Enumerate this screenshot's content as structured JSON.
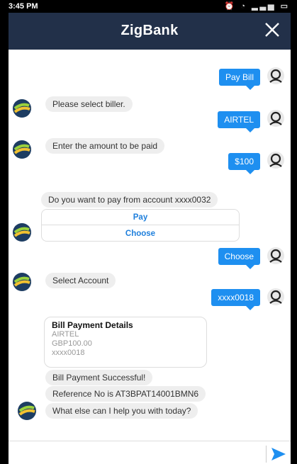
{
  "status_bar": {
    "time": "3:45 PM"
  },
  "header": {
    "title": "ZigBank"
  },
  "messages": {
    "user_1": "Pay Bill",
    "bot_1": "Please select biller.",
    "user_2": "AIRTEL",
    "bot_2": "Enter the amount to be paid",
    "user_3": "$100",
    "bot_3": "Do you want to pay from account xxxx0032",
    "options": [
      "Pay",
      "Choose"
    ],
    "user_4": "Choose",
    "bot_4": "Select Account",
    "user_5": "xxxx0018",
    "card": {
      "title": "Bill Payment Details",
      "lines": [
        "AIRTEL",
        "GBP100.00",
        "xxxx0018"
      ]
    },
    "bot_5": "Bill Payment Successful!",
    "bot_6": "Reference No is AT3BPAT14001BMN6",
    "bot_7": "What else can I help you with today?"
  },
  "colors": {
    "header_bg": "#223049",
    "user_bubble": "#1e8ff0",
    "bot_bubble": "#eeeeee",
    "send": "#1e8ff0"
  }
}
